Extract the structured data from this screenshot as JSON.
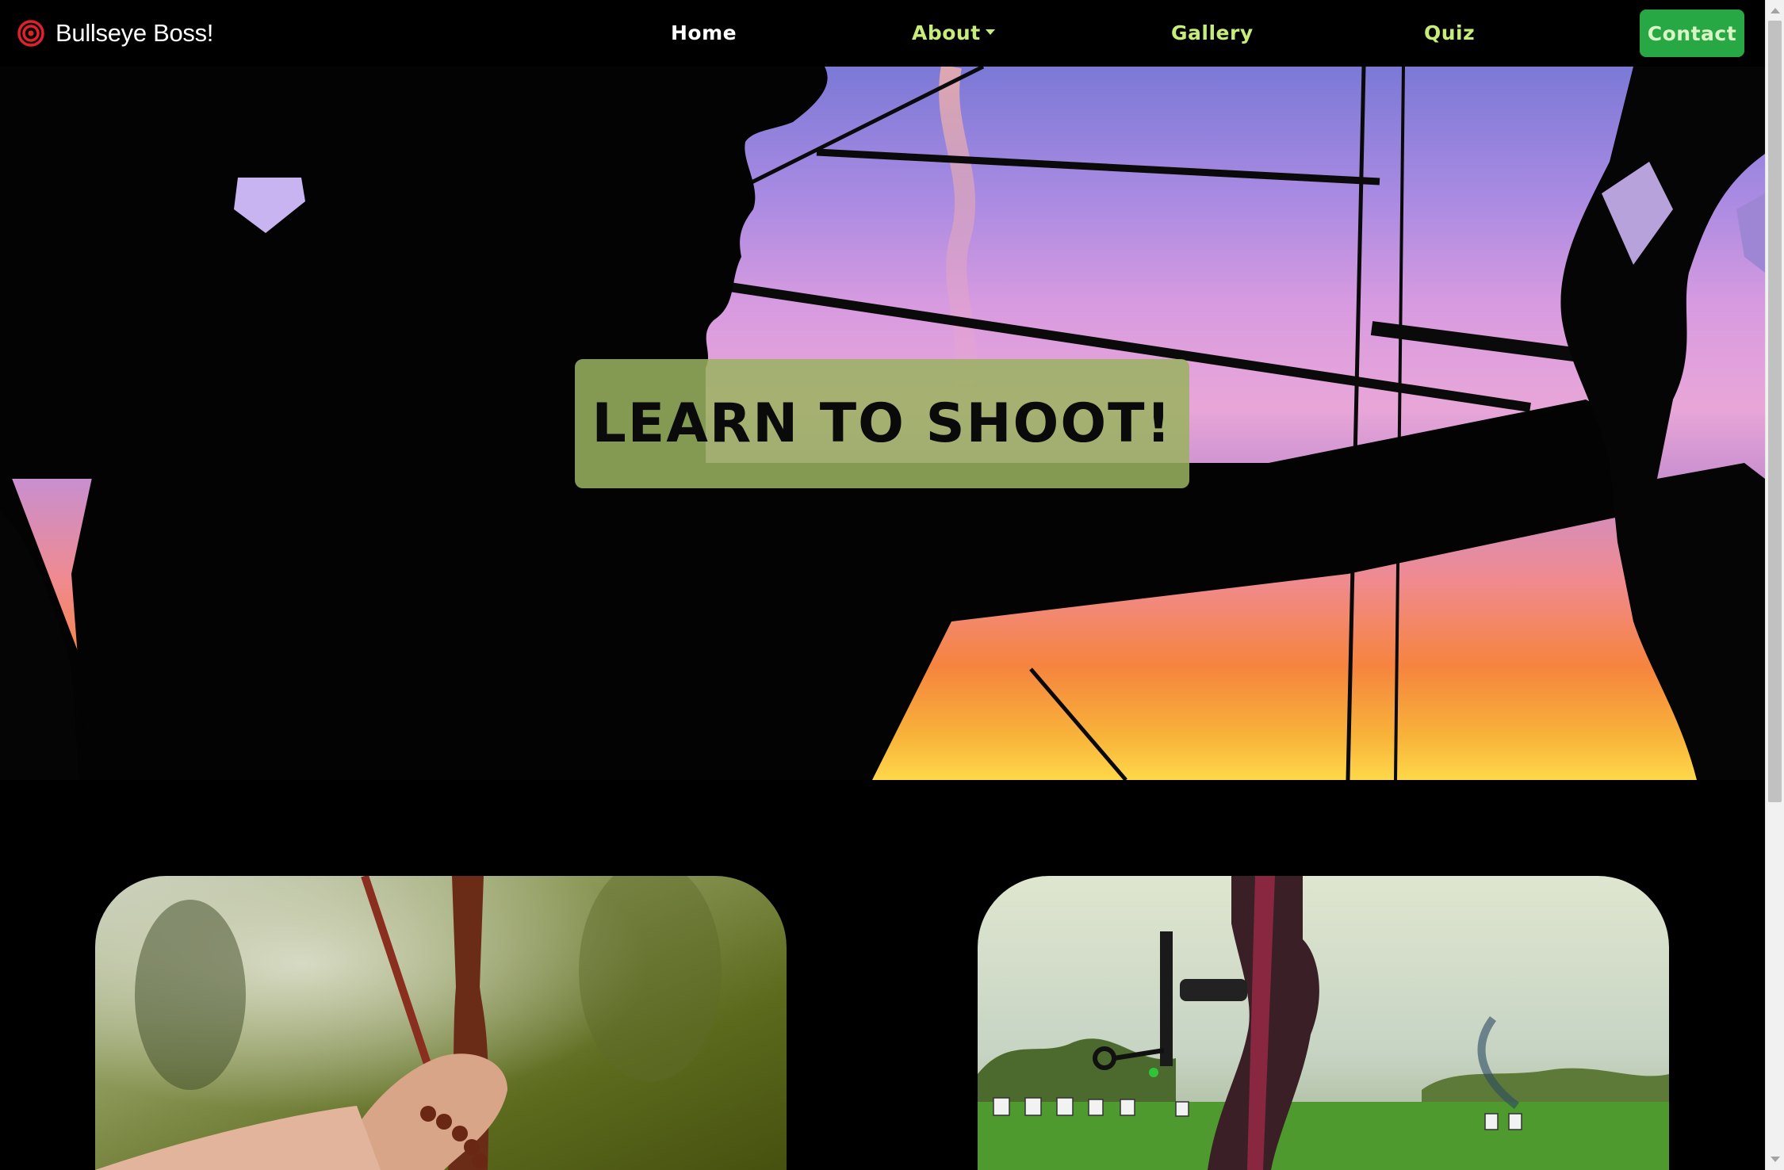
{
  "navbar": {
    "brand_name": "Bullseye Boss!",
    "brand_icon": "bullseye-target-icon",
    "links": {
      "home": "Home",
      "about": "About",
      "gallery": "Gallery",
      "quiz": "Quiz"
    },
    "contact_label": "Contact",
    "colors": {
      "link": "#c8ec7a",
      "active_link": "#ffffff",
      "contact_button": "#27a845",
      "brand_icon": "#e0202a"
    }
  },
  "hero": {
    "title": "LEARN TO SHOOT!",
    "box_color": "#9ab260"
  }
}
